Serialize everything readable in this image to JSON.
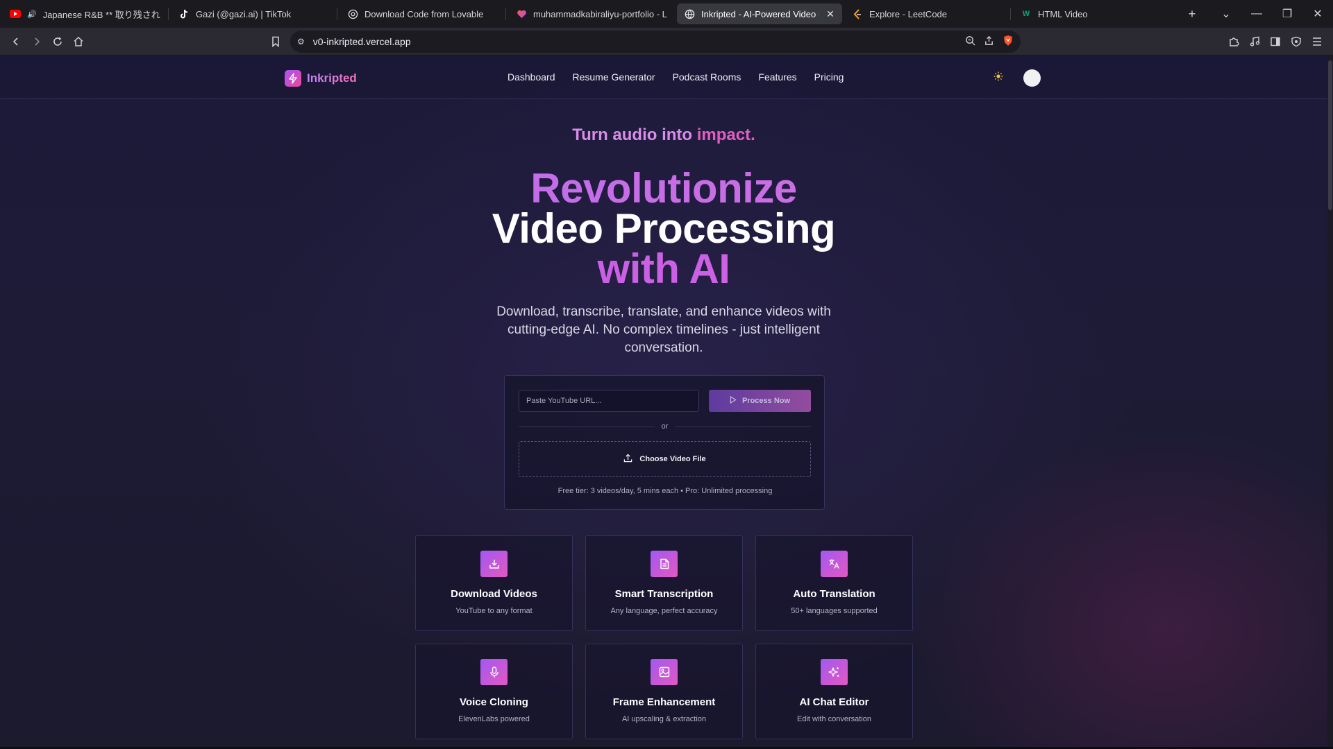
{
  "browser": {
    "tabs": [
      {
        "title": "Japanese R&B ** 取り残されたラブ",
        "favicon": "youtube-icon",
        "audio": true
      },
      {
        "title": "Gazi (@gazi.ai) | TikTok",
        "favicon": "tiktok-icon"
      },
      {
        "title": "Download Code from Lovable",
        "favicon": "globe-icon"
      },
      {
        "title": "muhammadkabiraliyu-portfolio - Lo",
        "favicon": "lovable-icon"
      },
      {
        "title": "Inkripted - AI-Powered Video P",
        "favicon": "globe-icon",
        "active": true
      },
      {
        "title": "Explore - LeetCode",
        "favicon": "leetcode-icon"
      },
      {
        "title": "HTML Video",
        "favicon": "w3schools-icon"
      }
    ],
    "url": "v0-inkripted.vercel.app"
  },
  "nav": {
    "brand": "Inkripted",
    "links": [
      "Dashboard",
      "Resume Generator",
      "Podcast Rooms",
      "Features",
      "Pricing"
    ],
    "theme_icon": "sun-icon"
  },
  "hero": {
    "tagline_a": "Turn audio into",
    "tagline_b": "impact.",
    "title_line1": "Revolutionize",
    "title_line2": "Video Processing",
    "title_line3": "with AI",
    "subtitle": "Download, transcribe, translate, and enhance videos with cutting-edge AI. No complex timelines - just intelligent conversation."
  },
  "upload": {
    "url_placeholder": "Paste YouTube URL...",
    "process_label": "Process Now",
    "or_label": "or",
    "file_label": "Choose Video File",
    "tier_note": "Free tier: 3 videos/day, 5 mins each • Pro: Unlimited processing"
  },
  "features": [
    {
      "icon": "download-icon",
      "title": "Download Videos",
      "desc": "YouTube to any format"
    },
    {
      "icon": "document-icon",
      "title": "Smart Transcription",
      "desc": "Any language, perfect accuracy"
    },
    {
      "icon": "translate-icon",
      "title": "Auto Translation",
      "desc": "50+ languages supported"
    },
    {
      "icon": "microphone-icon",
      "title": "Voice Cloning",
      "desc": "ElevenLabs powered"
    },
    {
      "icon": "image-icon",
      "title": "Frame Enhancement",
      "desc": "AI upscaling & extraction"
    },
    {
      "icon": "sparkles-icon",
      "title": "AI Chat Editor",
      "desc": "Edit with conversation"
    }
  ],
  "colors": {
    "accent_purple": "#a855f7",
    "accent_pink": "#ec4899",
    "background": "#1d1a3a"
  }
}
